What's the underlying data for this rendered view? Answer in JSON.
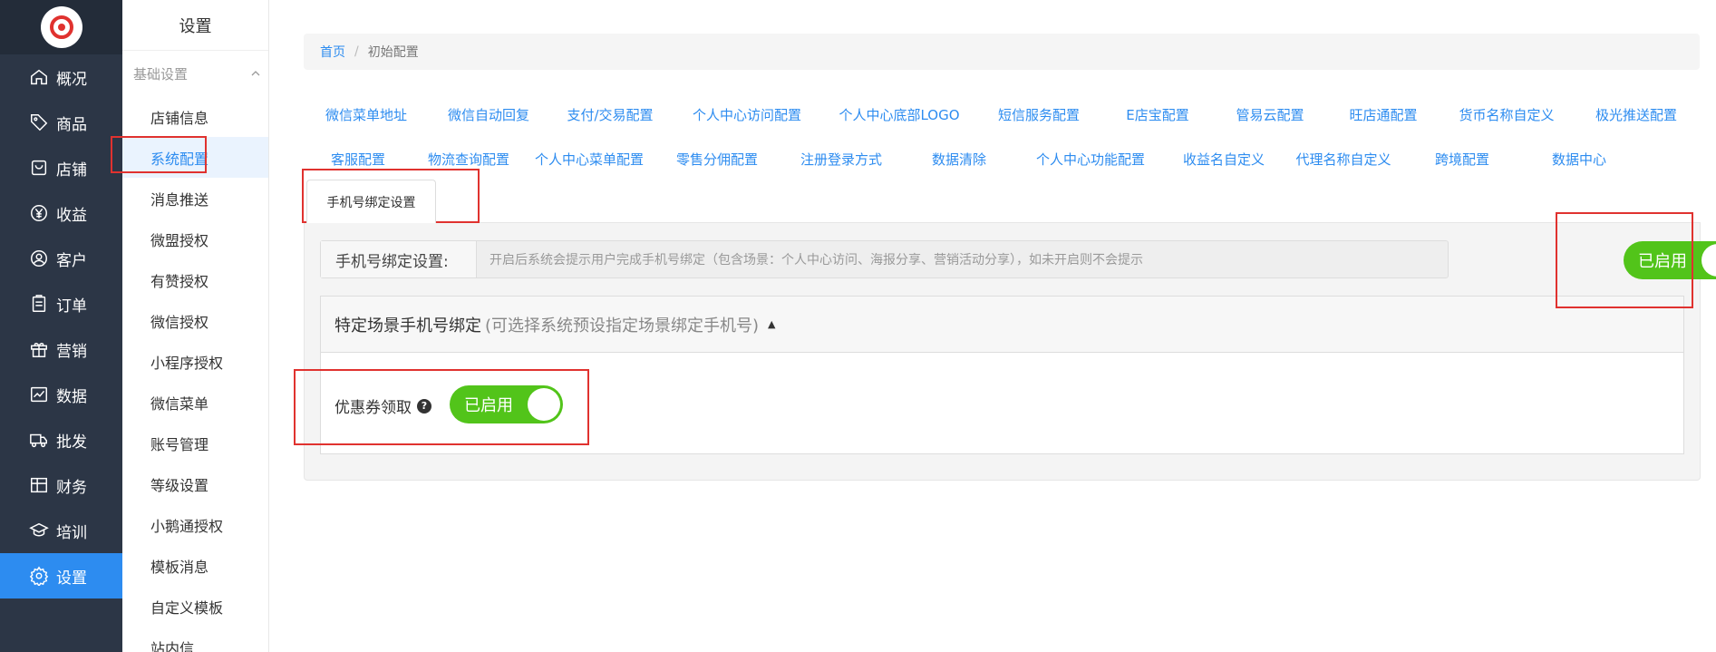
{
  "nav": {
    "items": [
      {
        "label": "概况",
        "icon": "home-icon"
      },
      {
        "label": "商品",
        "icon": "tag-icon"
      },
      {
        "label": "店铺",
        "icon": "shop-icon"
      },
      {
        "label": "收益",
        "icon": "yen-icon"
      },
      {
        "label": "客户",
        "icon": "user-icon"
      },
      {
        "label": "订单",
        "icon": "order-icon"
      },
      {
        "label": "营销",
        "icon": "gift-icon"
      },
      {
        "label": "数据",
        "icon": "chart-icon"
      },
      {
        "label": "批发",
        "icon": "truck-icon"
      },
      {
        "label": "财务",
        "icon": "ledger-icon"
      },
      {
        "label": "培训",
        "icon": "graduation-icon"
      },
      {
        "label": "设置",
        "icon": "gear-icon"
      }
    ]
  },
  "side": {
    "title": "设置",
    "group": "基础设置",
    "items": [
      "店铺信息",
      "系统配置",
      "消息推送",
      "微盟授权",
      "有赞授权",
      "微信授权",
      "小程序授权",
      "微信菜单",
      "账号管理",
      "等级设置",
      "小鹅通授权",
      "模板消息",
      "自定义模板",
      "站内信"
    ]
  },
  "breadcrumb": {
    "home": "首页",
    "sep": "/",
    "current": "初始配置"
  },
  "tabs": {
    "row1": [
      "微信菜单地址",
      "微信自动回复",
      "支付/交易配置",
      "个人中心访问配置",
      "个人中心底部LOGO",
      "短信服务配置",
      "E店宝配置",
      "管易云配置",
      "旺店通配置",
      "货币名称自定义",
      "极光推送配置"
    ],
    "row2": [
      "客服配置",
      "物流查询配置",
      "个人中心菜单配置",
      "零售分佣配置",
      "注册登录方式",
      "数据清除",
      "个人中心功能配置",
      "收益名自定义",
      "代理名称自定义",
      "跨境配置",
      "数据中心"
    ],
    "active": "手机号绑定设置"
  },
  "panel": {
    "addon": "手机号绑定设置:",
    "description": "开启后系统会提示用户完成手机号绑定（包含场景：个人中心访问、海报分享、营销活动分享），如未开启则不会提示",
    "switch_label": "已启用",
    "sub_title": "特定场景手机号绑定",
    "sub_hint": "(可选择系统预设指定场景绑定手机号)",
    "sub_caret": "▲",
    "option_label": "优惠券领取",
    "help_glyph": "?",
    "option_switch_label": "已启用"
  }
}
